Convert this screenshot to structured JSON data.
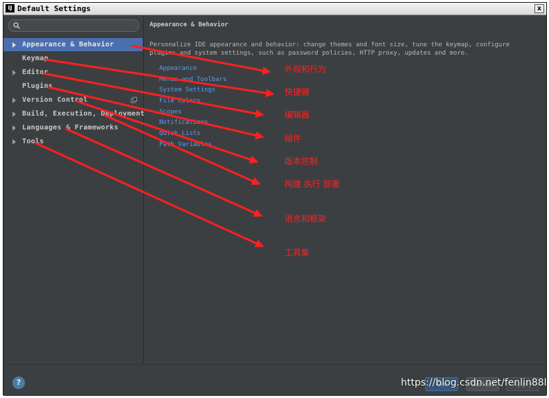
{
  "window": {
    "app_icon": "IJ",
    "title": "Default Settings",
    "close_glyph": "x"
  },
  "sidebar": {
    "search": {
      "value": "",
      "placeholder": ""
    },
    "items": [
      {
        "label": "Appearance & Behavior",
        "expandable": true,
        "selected": true
      },
      {
        "label": "Keymap",
        "expandable": false,
        "selected": false
      },
      {
        "label": "Editor",
        "expandable": true,
        "selected": false
      },
      {
        "label": "Plugins",
        "expandable": false,
        "selected": false
      },
      {
        "label": "Version Control",
        "expandable": true,
        "selected": false,
        "icon": "copy-icon"
      },
      {
        "label": "Build, Execution, Deployment",
        "expandable": true,
        "selected": false
      },
      {
        "label": "Languages & Frameworks",
        "expandable": true,
        "selected": false
      },
      {
        "label": "Tools",
        "expandable": true,
        "selected": false
      }
    ]
  },
  "main": {
    "title": "Appearance & Behavior",
    "description": "Personalize IDE appearance and behavior: change themes and font size, tune the keymap, configure plugins and system settings, such as password policies, HTTP proxy, updates and more.",
    "links": [
      "Appearance",
      "Menus and Toolbars",
      "System Settings",
      "File Colors",
      "Scopes",
      "Notifications",
      "Quick Lists",
      "Path Variables"
    ]
  },
  "footer": {
    "help": "?",
    "ok_label": "OK",
    "cancel_label": "Cancel",
    "apply_label": "Apply"
  },
  "annotations": {
    "color": "#ff2020",
    "labels": [
      "外观和行为",
      "快捷键",
      "编辑器",
      "插件",
      "版本控制",
      "构建 执行 部署",
      "语言和框架",
      "工具集"
    ]
  },
  "watermark": "https://blog.csdn.net/fenlin88l",
  "colors": {
    "background": "#3c3f41",
    "selection": "#4b6eaf",
    "link": "#589df6",
    "annotation": "#ff2020"
  }
}
